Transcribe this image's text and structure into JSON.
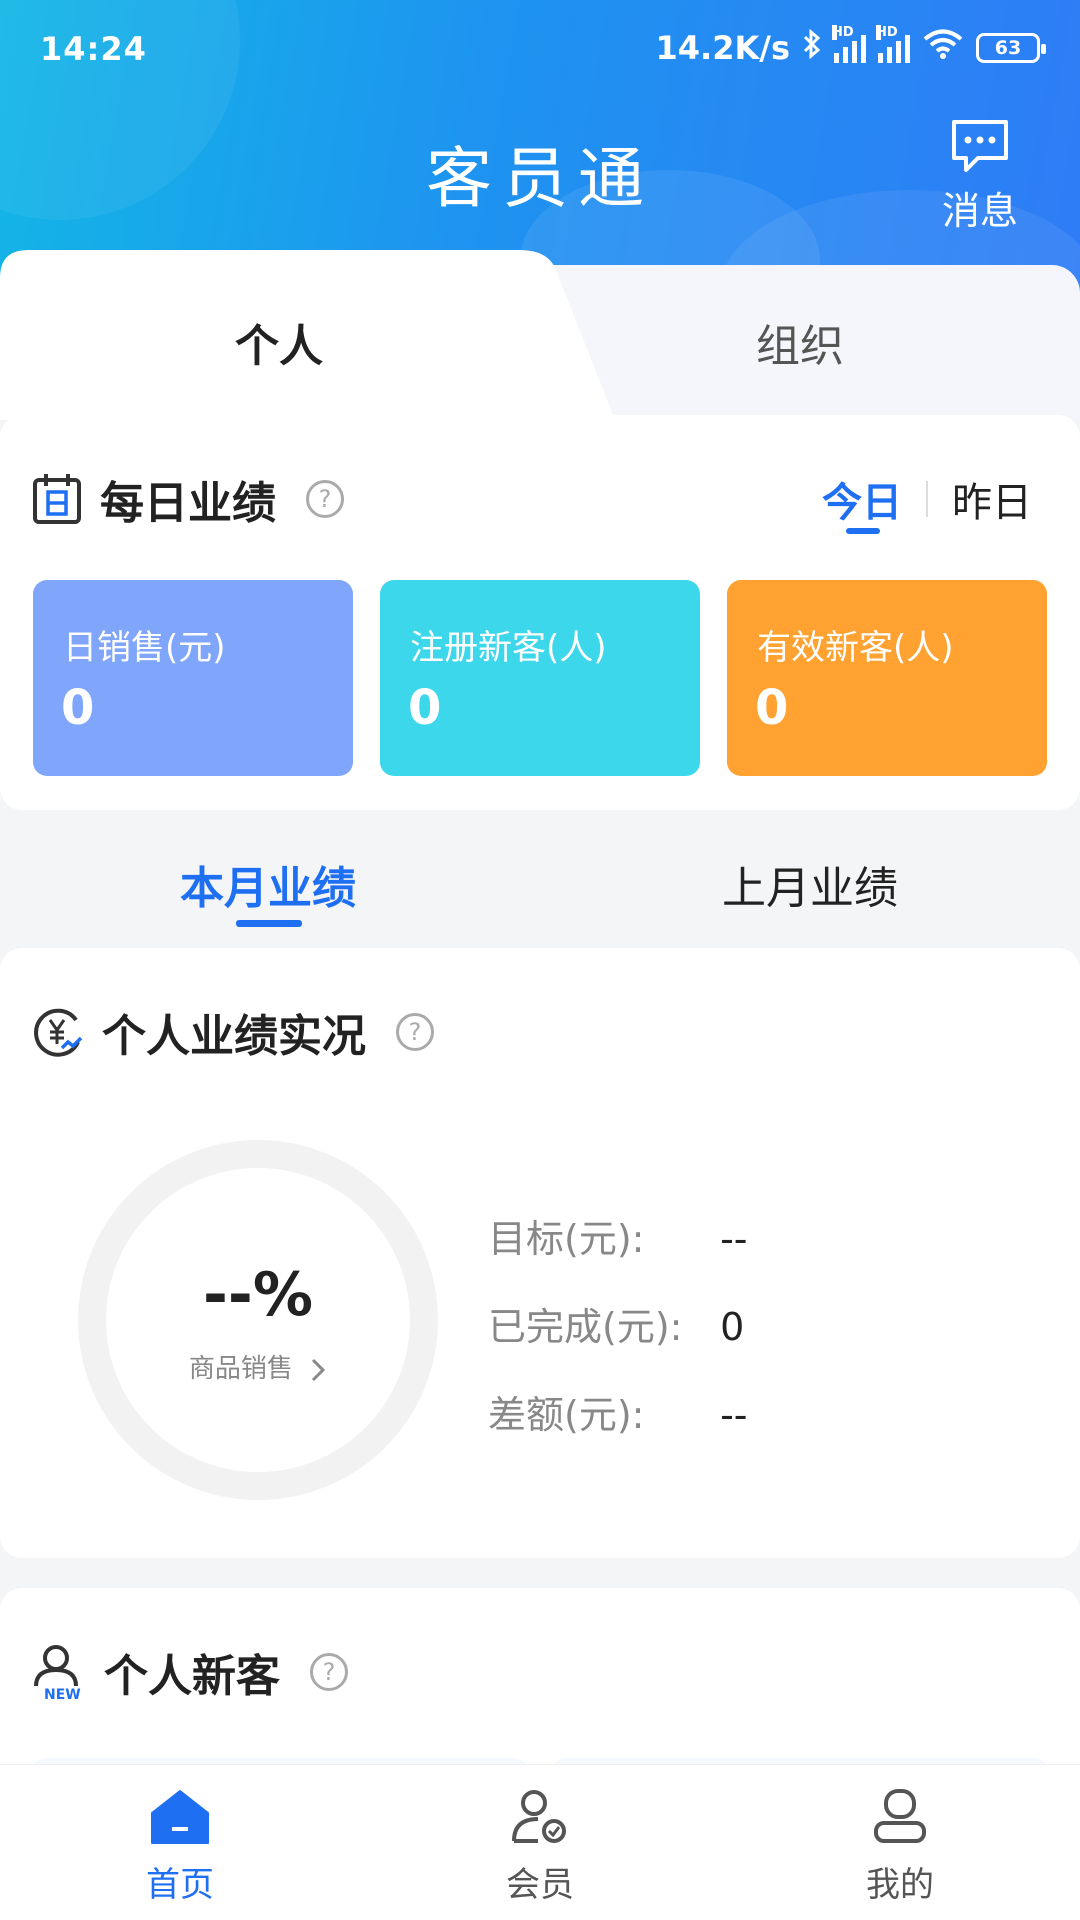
{
  "status_bar": {
    "time": "14:24",
    "net_speed": "14.2K/s",
    "battery": "63",
    "hd1": "HD",
    "hd2": "HD"
  },
  "header": {
    "title": "客员通",
    "message_label": "消息"
  },
  "scope_tabs": {
    "personal": "个人",
    "organization": "组织"
  },
  "daily": {
    "title": "每日业绩",
    "help": "?",
    "tab_today": "今日",
    "tab_yesterday": "昨日",
    "stats": [
      {
        "label": "日销售(元)",
        "value": "0",
        "color": "#7fa6fb"
      },
      {
        "label": "注册新客(人)",
        "value": "0",
        "color": "#3dd7ec"
      },
      {
        "label": "有效新客(人)",
        "value": "0",
        "color": "#ffa231"
      }
    ]
  },
  "month_tabs": {
    "this_month": "本月业绩",
    "last_month": "上月业绩"
  },
  "performance": {
    "title": "个人业绩实况",
    "help": "?",
    "percent": "--%",
    "category": "商品销售",
    "rows": [
      {
        "key": "目标(元):",
        "value": "--"
      },
      {
        "key": "已完成(元):",
        "value": "0"
      },
      {
        "key": "差额(元):",
        "value": "--"
      }
    ]
  },
  "new_customers": {
    "title": "个人新客",
    "help": "?",
    "icon_badge": "NEW"
  },
  "bottom_nav": [
    {
      "label": "首页",
      "active": true
    },
    {
      "label": "会员",
      "active": false
    },
    {
      "label": "我的",
      "active": false
    }
  ],
  "colors": {
    "accent": "#1f6ff2",
    "header_gradient_start": "#13b6e6",
    "header_gradient_end": "#2f7cf6"
  }
}
